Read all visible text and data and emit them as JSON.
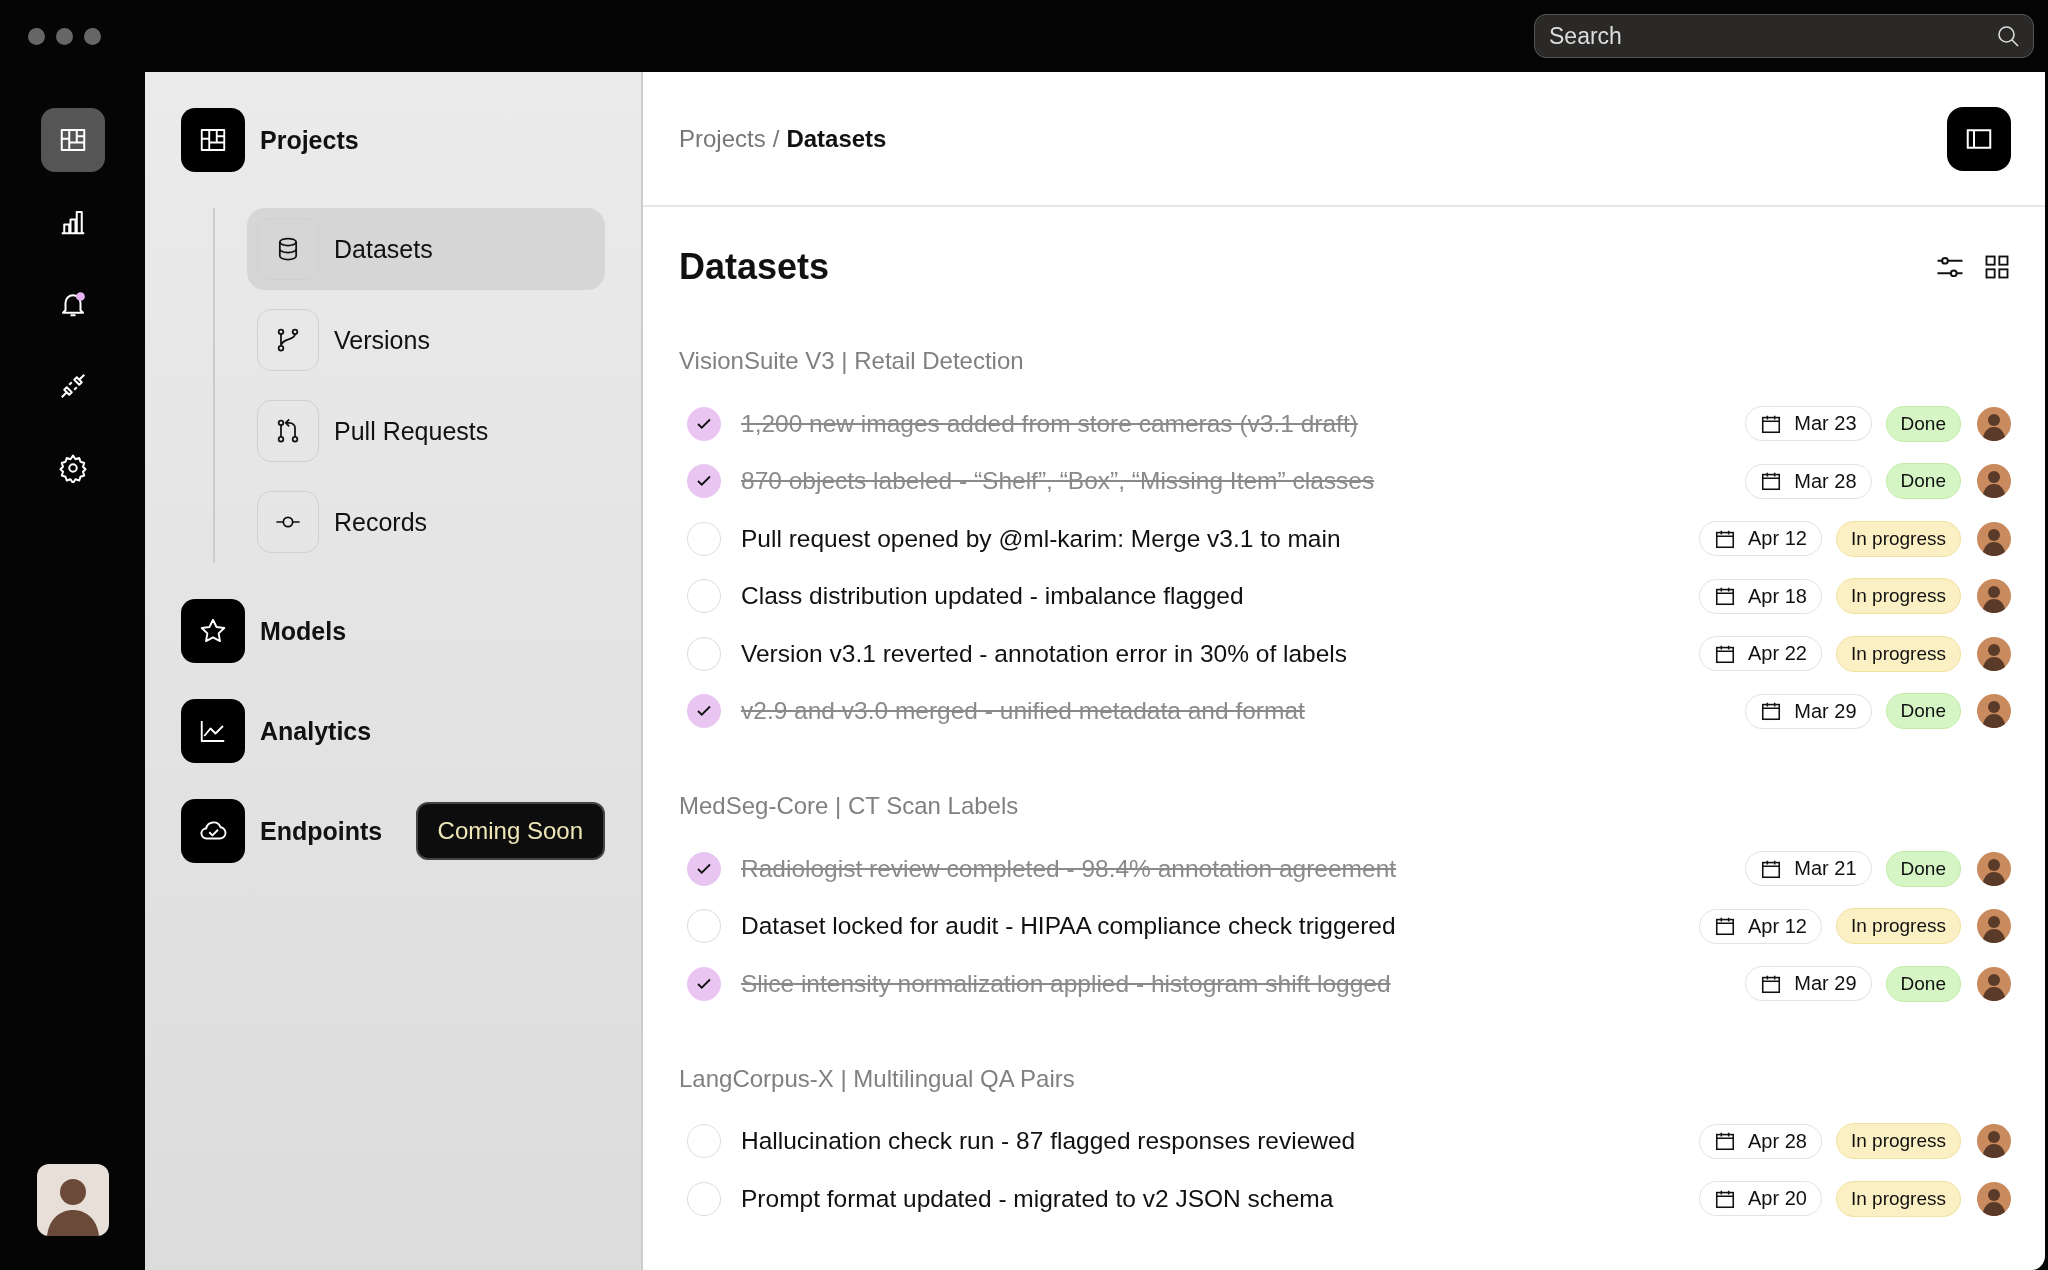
{
  "search": {
    "placeholder": "Search"
  },
  "rail": [
    {
      "selected": true,
      "notification": false
    },
    {
      "selected": false,
      "notification": false
    },
    {
      "selected": false,
      "notification": true
    },
    {
      "selected": false,
      "notification": false
    },
    {
      "selected": false,
      "notification": false
    }
  ],
  "sidebar": {
    "items": [
      {
        "label": "Projects",
        "children": [
          {
            "label": "Datasets",
            "selected": true
          },
          {
            "label": "Versions",
            "selected": false
          },
          {
            "label": "Pull Requests",
            "selected": false
          },
          {
            "label": "Records",
            "selected": false
          }
        ]
      },
      {
        "label": "Models"
      },
      {
        "label": "Analytics"
      },
      {
        "label": "Endpoints",
        "tag": "Coming Soon"
      }
    ]
  },
  "breadcrumb": {
    "parent": "Projects",
    "separator": "/",
    "current": "Datasets"
  },
  "page_title": "Datasets",
  "groups": [
    {
      "title": "VisionSuite V3 | Retail Detection",
      "tasks": [
        {
          "text": "1,200 new images added from store cameras (v3.1 draft)",
          "checked": true,
          "date": "Mar 23",
          "status": {
            "label": "Done",
            "kind": "done"
          }
        },
        {
          "text": "870 objects labeled - “Shelf”, “Box”, “Missing Item” classes",
          "checked": true,
          "date": "Mar 28",
          "status": {
            "label": "Done",
            "kind": "done"
          }
        },
        {
          "text": "Pull request opened by @ml-karim: Merge v3.1 to main",
          "checked": false,
          "date": "Apr 12",
          "status": {
            "label": "In progress",
            "kind": "in_progress"
          }
        },
        {
          "text": "Class distribution updated - imbalance flagged",
          "checked": false,
          "date": "Apr 18",
          "status": {
            "label": "In progress",
            "kind": "in_progress"
          }
        },
        {
          "text": "Version v3.1 reverted - annotation error in 30% of labels",
          "checked": false,
          "date": "Apr 22",
          "status": {
            "label": "In progress",
            "kind": "in_progress"
          }
        },
        {
          "text": "v2.9 and v3.0 merged - unified metadata and format",
          "checked": true,
          "date": "Mar 29",
          "status": {
            "label": "Done",
            "kind": "done"
          }
        }
      ]
    },
    {
      "title": "MedSeg-Core | CT Scan Labels",
      "tasks": [
        {
          "text": "Radiologist review completed - 98.4% annotation agreement",
          "checked": true,
          "date": "Mar 21",
          "status": {
            "label": "Done",
            "kind": "done"
          }
        },
        {
          "text": "Dataset locked for audit - HIPAA compliance check triggered",
          "checked": false,
          "date": "Apr 12",
          "status": {
            "label": "In progress",
            "kind": "in_progress"
          }
        },
        {
          "text": "Slice intensity normalization applied - histogram shift logged",
          "checked": true,
          "date": "Mar 29",
          "status": {
            "label": "Done",
            "kind": "done"
          }
        }
      ]
    },
    {
      "title": "LangCorpus-X | Multilingual QA Pairs",
      "tasks": [
        {
          "text": "Hallucination check run - 87 flagged responses reviewed",
          "checked": false,
          "date": "Apr 28",
          "status": {
            "label": "In progress",
            "kind": "in_progress"
          }
        },
        {
          "text": "Prompt format updated - migrated to v2 JSON schema",
          "checked": false,
          "date": "Apr 20",
          "status": {
            "label": "In progress",
            "kind": "in_progress"
          }
        }
      ]
    }
  ]
}
